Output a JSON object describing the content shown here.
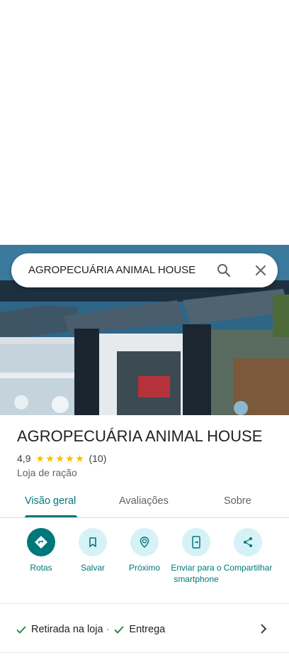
{
  "search": {
    "query": "AGROPECUÁRIA ANIMAL HOUSE"
  },
  "place": {
    "name": "AGROPECUÁRIA ANIMAL HOUSE",
    "rating": "4,9",
    "stars": 5,
    "review_count": "(10)",
    "category": "Loja de ração"
  },
  "tabs": [
    {
      "label": "Visão geral",
      "active": true
    },
    {
      "label": "Avaliações",
      "active": false
    },
    {
      "label": "Sobre",
      "active": false
    }
  ],
  "actions": [
    {
      "label": "Rotas",
      "icon": "directions-icon"
    },
    {
      "label": "Salvar",
      "icon": "bookmark-icon"
    },
    {
      "label": "Próximo",
      "icon": "nearby-icon"
    },
    {
      "label": "Enviar para o smartphone",
      "icon": "send-to-phone-icon"
    },
    {
      "label": "Compartilhar",
      "icon": "share-icon"
    }
  ],
  "services": {
    "item1": "Retirada na loja",
    "separator": "·",
    "item2": "Entrega"
  },
  "colors": {
    "accent": "#00777b",
    "accent_light": "#d6f2f6",
    "star": "#fbbc04",
    "check": "#188038"
  }
}
